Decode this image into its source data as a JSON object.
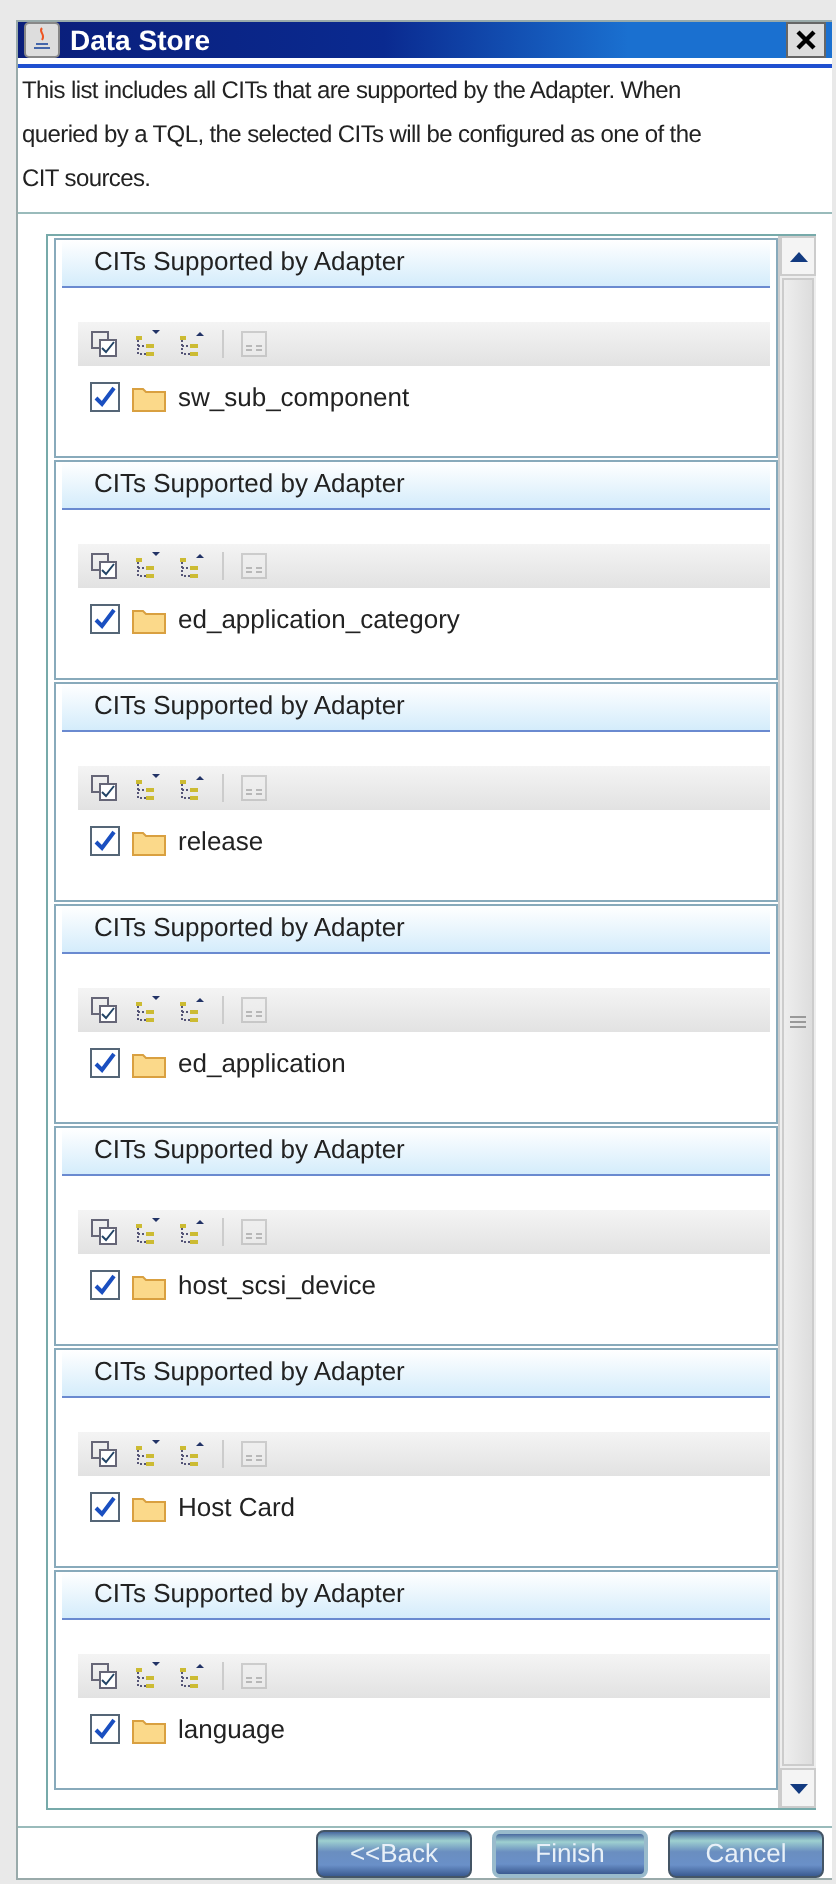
{
  "window": {
    "title": "Data Store"
  },
  "description": "This list includes all CITs that are supported by the Adapter. When queried by a TQL, the selected CITs will be configured as one of the CIT sources.",
  "sections": [
    {
      "header": "CITs Supported by Adapter",
      "item": {
        "label": "sw_sub_component",
        "checked": true
      }
    },
    {
      "header": "CITs Supported by Adapter",
      "item": {
        "label": "ed_application_category",
        "checked": true
      }
    },
    {
      "header": "CITs Supported by Adapter",
      "item": {
        "label": "release",
        "checked": true
      }
    },
    {
      "header": "CITs Supported by Adapter",
      "item": {
        "label": "ed_application",
        "checked": true
      }
    },
    {
      "header": "CITs Supported by Adapter",
      "item": {
        "label": "host_scsi_device",
        "checked": true
      }
    },
    {
      "header": "CITs Supported by Adapter",
      "item": {
        "label": "Host Card",
        "checked": true
      }
    },
    {
      "header": "CITs Supported by Adapter",
      "item": {
        "label": "language",
        "checked": true
      }
    }
  ],
  "buttons": [
    "<<Back",
    "Finish",
    "Cancel"
  ]
}
